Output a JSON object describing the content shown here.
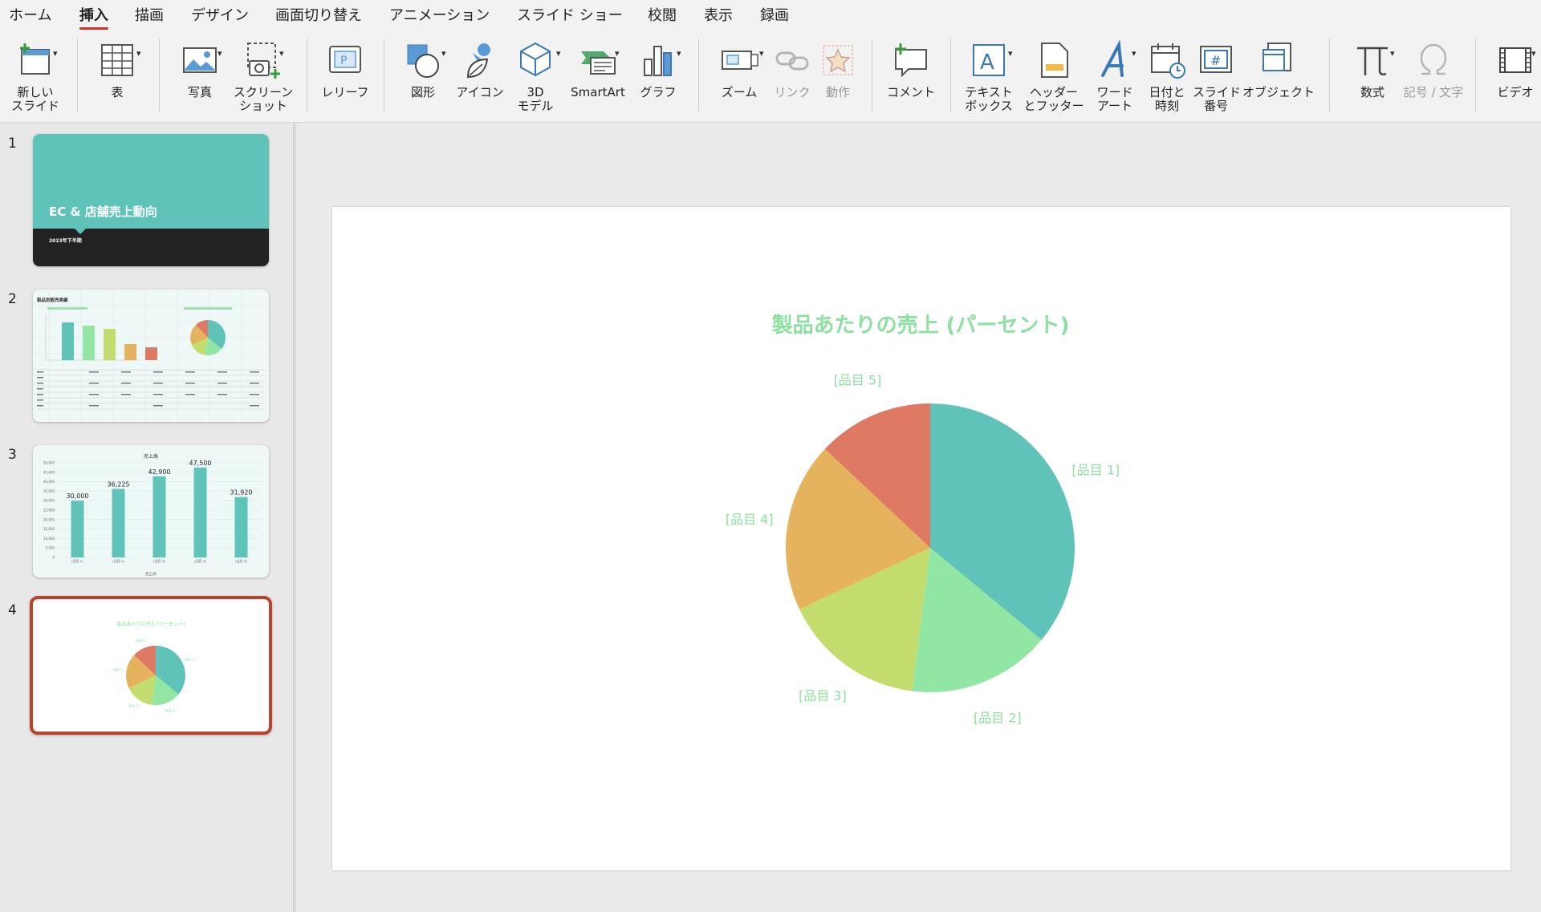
{
  "menu_tabs": [
    {
      "label": "ホーム",
      "active": false
    },
    {
      "label": "挿入",
      "active": true
    },
    {
      "label": "描画",
      "active": false
    },
    {
      "label": "デザイン",
      "active": false
    },
    {
      "label": "画面切り替え",
      "active": false
    },
    {
      "label": "アニメーション",
      "active": false
    },
    {
      "label": "スライド ショー",
      "active": false
    },
    {
      "label": "校閲",
      "active": false
    },
    {
      "label": "表示",
      "active": false
    },
    {
      "label": "録画",
      "active": false
    }
  ],
  "ribbon": {
    "new_slide": "新しい\nスライド",
    "table": "表",
    "photo": "写真",
    "screenshot": "スクリーン\nショット",
    "cameo": "レリーフ",
    "shapes": "図形",
    "icons": "アイコン",
    "model3d": "3D\nモデル",
    "smartart": "SmartArt",
    "chart": "グラフ",
    "zoom": "ズーム",
    "link": "リンク",
    "action": "動作",
    "comment": "コメント",
    "textbox": "テキスト\nボックス",
    "header_footer": "ヘッダー\nとフッター",
    "wordart": "ワード\nアート",
    "datetime": "日付と\n時刻",
    "slide_number": "スライド\n番号",
    "object": "オブジェクト",
    "equation": "数式",
    "symbol": "記号 / 文字",
    "video": "ビデオ"
  },
  "slides": [
    {
      "number": "1",
      "title": "EC & 店舗売上動向",
      "subtitle": "2023年下半期"
    },
    {
      "number": "2",
      "title": "製品別販売実績"
    },
    {
      "number": "3",
      "title": "売上高",
      "axis_label": "売上高",
      "value_labels": [
        "30,000",
        "36,225",
        "42,900",
        "47,500",
        "31,920"
      ],
      "ticks": [
        "50,000",
        "45,000",
        "40,000",
        "35,000",
        "30,000",
        "25,000",
        "20,000",
        "15,000",
        "10,000",
        "5,000",
        "0"
      ],
      "categories": [
        "[品目 1]",
        "[品目 2]",
        "[品目 3]",
        "[品目 4]",
        "[品目 5]"
      ]
    },
    {
      "number": "4",
      "selected": true
    }
  ],
  "chart_data": {
    "type": "pie",
    "title": "製品あたりの売上 (パーセント)",
    "categories": [
      "[品目 1]",
      "[品目 2]",
      "[品目 3]",
      "[品目 4]",
      "[品目 5]"
    ],
    "values": [
      36,
      16,
      16,
      19,
      13
    ],
    "colors": [
      "#5fc3b9",
      "#92e6a4",
      "#c3dc6e",
      "#e5b25d",
      "#de7a64"
    ],
    "title_color": "#8ee0a0",
    "label_color": "#8ee0a0",
    "bar_color": "#5fc3b9"
  }
}
